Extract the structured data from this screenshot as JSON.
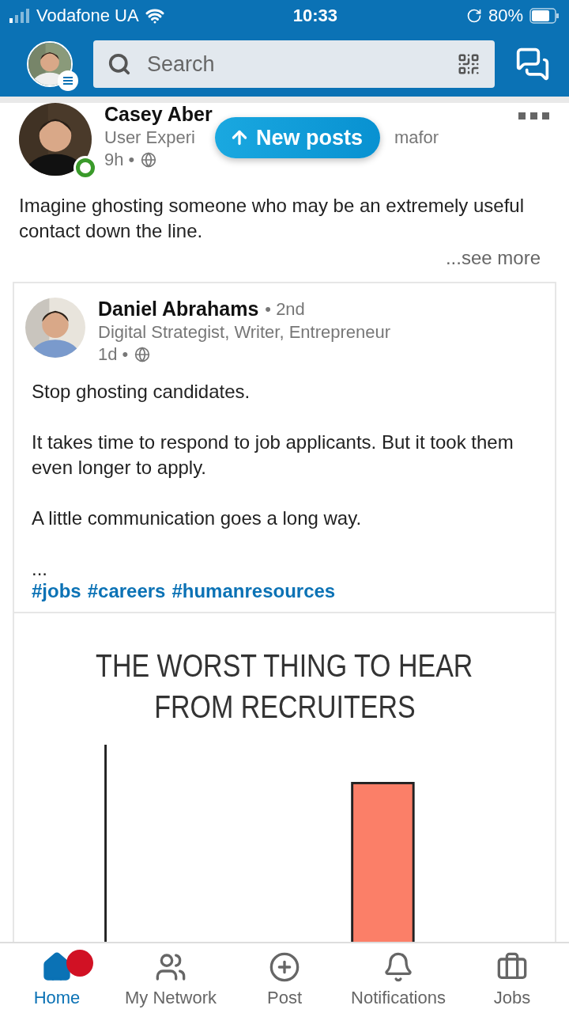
{
  "status_bar": {
    "carrier": "Vodafone UA",
    "time": "10:33",
    "battery": "80%"
  },
  "header": {
    "search": {
      "placeholder": "Search"
    }
  },
  "new_posts": "New posts",
  "post": {
    "author": {
      "name": "Casey Aber",
      "headline_start": "User Experi",
      "headline_end": "mafor",
      "time": "9h •",
      "online": true
    },
    "text": "Imagine ghosting someone who may be an extremely useful contact down the line.",
    "see_more": "...see more",
    "shared": {
      "author": {
        "name": "Daniel Abrahams",
        "degree": "• 2nd",
        "headline": "Digital Strategist, Writer, Entrepreneur",
        "time": "1d •"
      },
      "paragraphs": [
        "Stop ghosting candidates.",
        "It takes time to respond to job applicants. But it took them even longer to apply.",
        "A little communication goes a long way.",
        "..."
      ],
      "hashtags": [
        "#jobs",
        "#careers",
        "#humanresources"
      ],
      "image": {
        "title_lines": [
          "THE WORST THING TO HEAR",
          "FROM RECRUITERS"
        ]
      }
    }
  },
  "nav": [
    {
      "kind": "home",
      "label": "Home",
      "selected": true,
      "badge": true
    },
    {
      "kind": "network",
      "label": "My Network",
      "selected": false,
      "badge": false
    },
    {
      "kind": "post",
      "label": "Post",
      "selected": false,
      "badge": false
    },
    {
      "kind": "notifications",
      "label": "Notifications",
      "selected": false,
      "badge": false
    },
    {
      "kind": "jobs",
      "label": "Jobs",
      "selected": false,
      "badge": false
    }
  ]
}
